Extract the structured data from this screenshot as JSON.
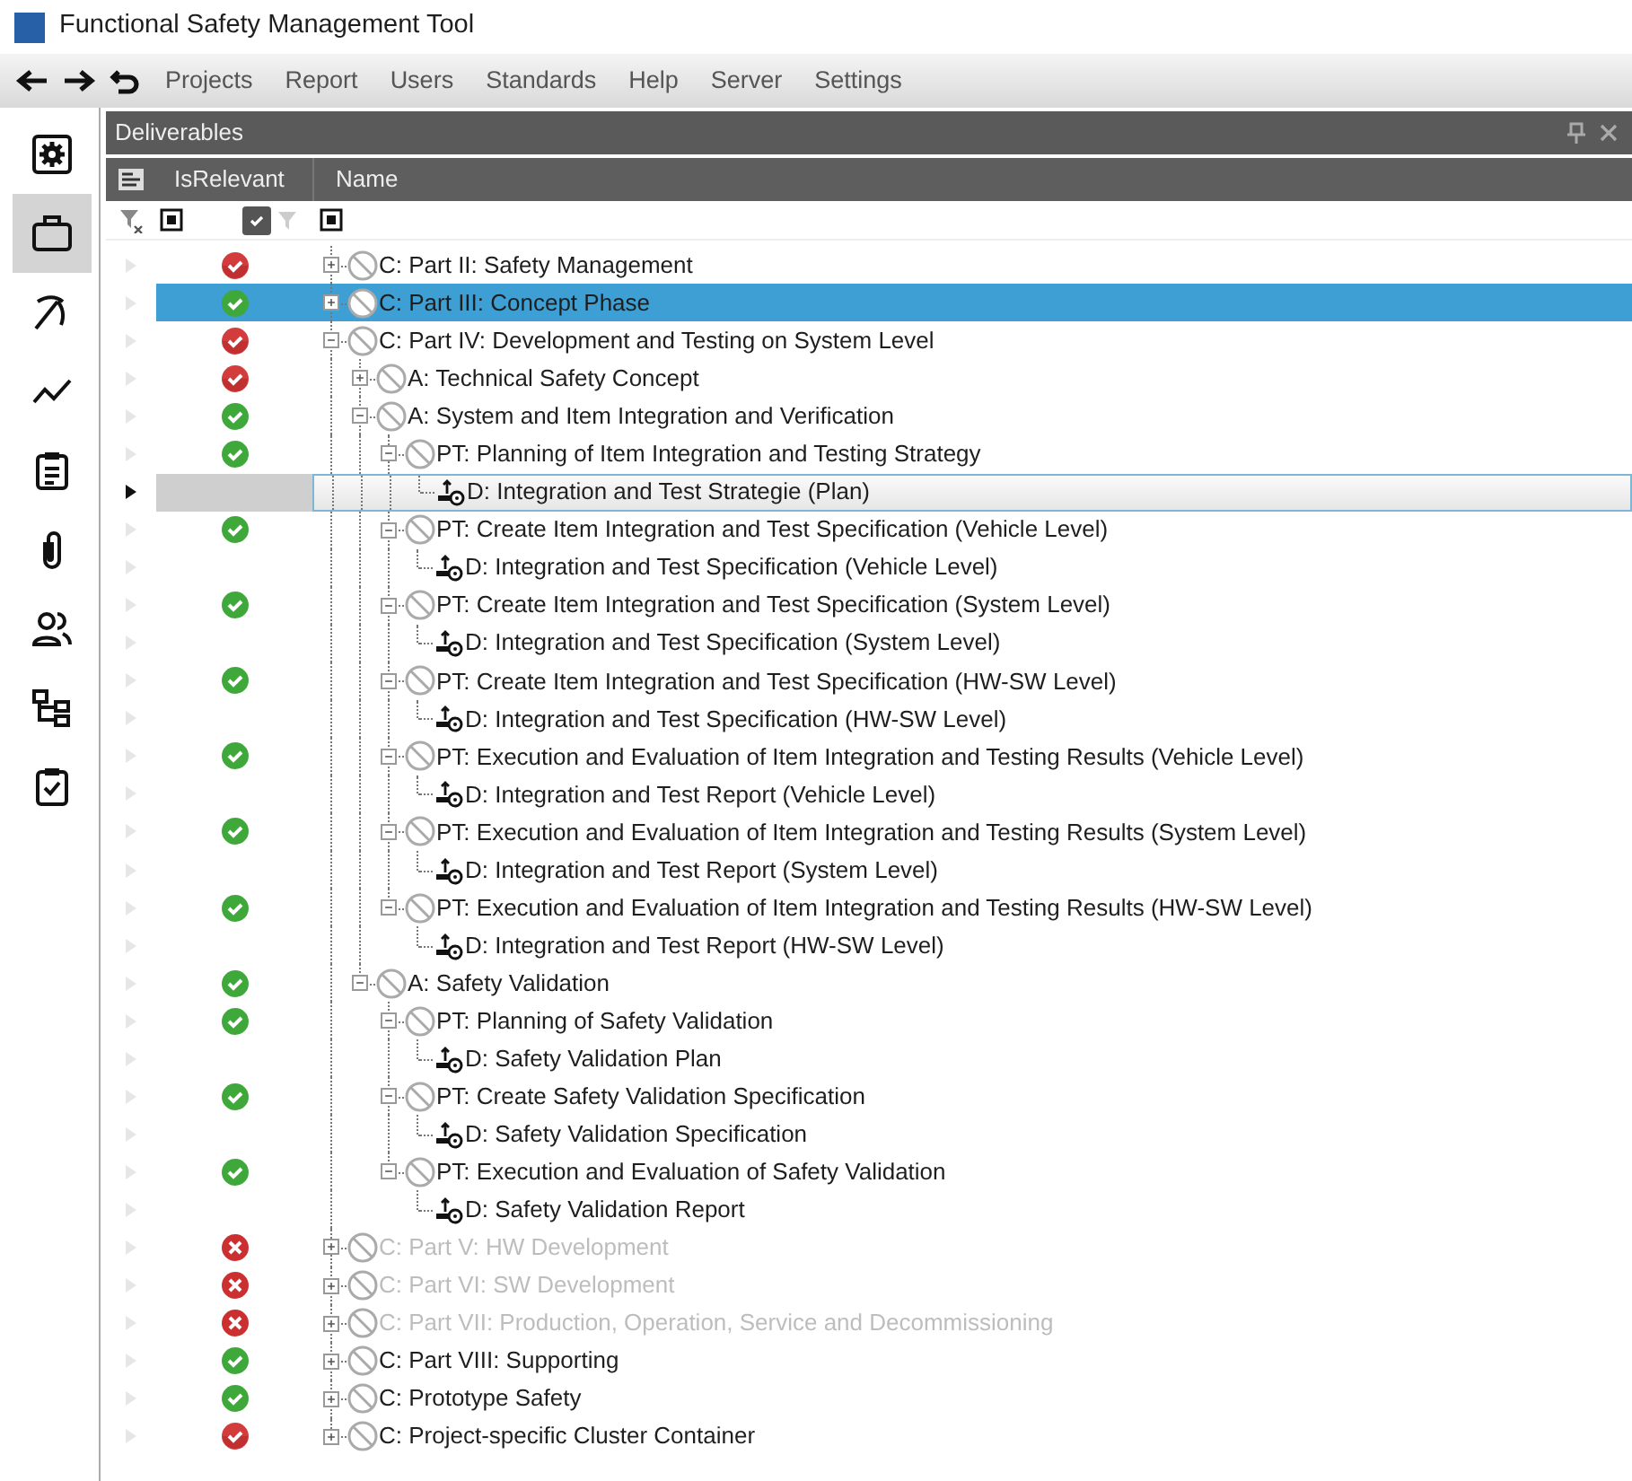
{
  "window": {
    "title": "Functional Safety Management Tool"
  },
  "menu": {
    "items": [
      "Projects",
      "Report",
      "Users",
      "Standards",
      "Help",
      "Server",
      "Settings"
    ]
  },
  "sidebar": {
    "items": [
      {
        "selected": false
      },
      {
        "selected": true
      },
      {
        "selected": false
      },
      {
        "selected": false
      },
      {
        "selected": false
      },
      {
        "selected": false
      },
      {
        "selected": false
      },
      {
        "selected": false
      },
      {
        "selected": false
      }
    ]
  },
  "panel": {
    "title": "Deliverables",
    "columns": [
      "IsRelevant",
      "Name"
    ],
    "rows": [
      {
        "kind": "container",
        "name": "C: Part II: Safety Management",
        "relevant": true,
        "partial": true,
        "expanded": false,
        "selected": false,
        "current": false,
        "disabled": false
      },
      {
        "kind": "container",
        "name": "C: Part III: Concept Phase",
        "relevant": true,
        "partial": false,
        "expanded": false,
        "selected": true,
        "current": false,
        "disabled": false
      },
      {
        "kind": "container",
        "name": "C: Part IV: Development and Testing on System Level",
        "relevant": true,
        "partial": true,
        "expanded": true,
        "selected": false,
        "current": false,
        "disabled": false,
        "children": [
          {
            "kind": "container",
            "name": "A: Technical Safety Concept",
            "relevant": true,
            "partial": true,
            "expanded": false,
            "selected": false,
            "current": false,
            "disabled": false
          },
          {
            "kind": "container",
            "name": "A: System and Item Integration and Verification",
            "relevant": true,
            "partial": false,
            "expanded": true,
            "selected": false,
            "current": false,
            "disabled": false,
            "children": [
              {
                "kind": "container",
                "name": "PT: Planning of Item Integration and Testing Strategy",
                "relevant": true,
                "partial": false,
                "expanded": true,
                "selected": false,
                "current": false,
                "disabled": false,
                "children": [
                  {
                    "kind": "deliverable",
                    "name": "D: Integration and Test Strategie (Plan)",
                    "selected": false,
                    "current": true,
                    "disabled": false
                  }
                ]
              },
              {
                "kind": "container",
                "name": "PT: Create Item Integration and Test Specification (Vehicle Level)",
                "relevant": true,
                "partial": false,
                "expanded": true,
                "selected": false,
                "current": false,
                "disabled": false,
                "children": [
                  {
                    "kind": "deliverable",
                    "name": "D: Integration and Test Specification (Vehicle Level)",
                    "selected": false,
                    "current": false,
                    "disabled": false
                  }
                ]
              },
              {
                "kind": "container",
                "name": "PT: Create Item Integration and Test Specification (System Level)",
                "relevant": true,
                "partial": false,
                "expanded": true,
                "selected": false,
                "current": false,
                "disabled": false,
                "children": [
                  {
                    "kind": "deliverable",
                    "name": "D: Integration and Test Specification (System Level)",
                    "selected": false,
                    "current": false,
                    "disabled": false
                  }
                ]
              },
              {
                "kind": "container",
                "name": "PT: Create Item Integration and Test Specification (HW-SW Level)",
                "relevant": true,
                "partial": false,
                "expanded": true,
                "selected": false,
                "current": false,
                "disabled": false,
                "children": [
                  {
                    "kind": "deliverable",
                    "name": "D: Integration and Test Specification (HW-SW Level)",
                    "selected": false,
                    "current": false,
                    "disabled": false
                  }
                ]
              },
              {
                "kind": "container",
                "name": "PT: Execution and Evaluation of Item Integration and Testing Results (Vehicle Level)",
                "relevant": true,
                "partial": false,
                "expanded": true,
                "selected": false,
                "current": false,
                "disabled": false,
                "children": [
                  {
                    "kind": "deliverable",
                    "name": "D: Integration and Test Report (Vehicle Level)",
                    "selected": false,
                    "current": false,
                    "disabled": false
                  }
                ]
              },
              {
                "kind": "container",
                "name": "PT: Execution and Evaluation of Item Integration and Testing Results (System Level)",
                "relevant": true,
                "partial": false,
                "expanded": true,
                "selected": false,
                "current": false,
                "disabled": false,
                "children": [
                  {
                    "kind": "deliverable",
                    "name": "D: Integration and Test Report (System Level)",
                    "selected": false,
                    "current": false,
                    "disabled": false
                  }
                ]
              },
              {
                "kind": "container",
                "name": "PT: Execution and Evaluation of Item Integration and Testing Results (HW-SW Level)",
                "relevant": true,
                "partial": false,
                "expanded": true,
                "selected": false,
                "current": false,
                "disabled": false,
                "children": [
                  {
                    "kind": "deliverable",
                    "name": "D: Integration and Test Report (HW-SW Level)",
                    "selected": false,
                    "current": false,
                    "disabled": false
                  }
                ]
              }
            ]
          },
          {
            "kind": "container",
            "name": "A: Safety Validation",
            "relevant": true,
            "partial": false,
            "expanded": true,
            "selected": false,
            "current": false,
            "disabled": false,
            "children": [
              {
                "kind": "container",
                "name": "PT: Planning of Safety Validation",
                "relevant": true,
                "partial": false,
                "expanded": true,
                "selected": false,
                "current": false,
                "disabled": false,
                "children": [
                  {
                    "kind": "deliverable",
                    "name": "D: Safety Validation Plan",
                    "selected": false,
                    "current": false,
                    "disabled": false
                  }
                ]
              },
              {
                "kind": "container",
                "name": "PT: Create Safety Validation Specification",
                "relevant": true,
                "partial": false,
                "expanded": true,
                "selected": false,
                "current": false,
                "disabled": false,
                "children": [
                  {
                    "kind": "deliverable",
                    "name": "D: Safety Validation Specification",
                    "selected": false,
                    "current": false,
                    "disabled": false
                  }
                ]
              },
              {
                "kind": "container",
                "name": "PT: Execution and Evaluation of Safety Validation",
                "relevant": true,
                "partial": false,
                "expanded": true,
                "selected": false,
                "current": false,
                "disabled": false,
                "children": [
                  {
                    "kind": "deliverable",
                    "name": "D: Safety Validation Report",
                    "selected": false,
                    "current": false,
                    "disabled": false
                  }
                ]
              }
            ]
          }
        ]
      },
      {
        "kind": "container",
        "name": "C: Part V: HW Development",
        "relevant": false,
        "expanded": false,
        "selected": false,
        "current": false,
        "disabled": true
      },
      {
        "kind": "container",
        "name": "C: Part VI: SW Development",
        "relevant": false,
        "expanded": false,
        "selected": false,
        "current": false,
        "disabled": true
      },
      {
        "kind": "container",
        "name": "C: Part VII: Production, Operation, Service and Decommissioning",
        "relevant": false,
        "expanded": false,
        "selected": false,
        "current": false,
        "disabled": true
      },
      {
        "kind": "container",
        "name": "C: Part VIII: Supporting",
        "relevant": true,
        "partial": false,
        "expanded": false,
        "selected": false,
        "current": false,
        "disabled": false
      },
      {
        "kind": "container",
        "name": "C: Prototype Safety",
        "relevant": true,
        "partial": false,
        "expanded": false,
        "selected": false,
        "current": false,
        "disabled": false
      },
      {
        "kind": "container",
        "name": "C: Project-specific Cluster Container",
        "relevant": true,
        "partial": true,
        "expanded": false,
        "selected": false,
        "current": false,
        "disabled": false
      }
    ]
  }
}
